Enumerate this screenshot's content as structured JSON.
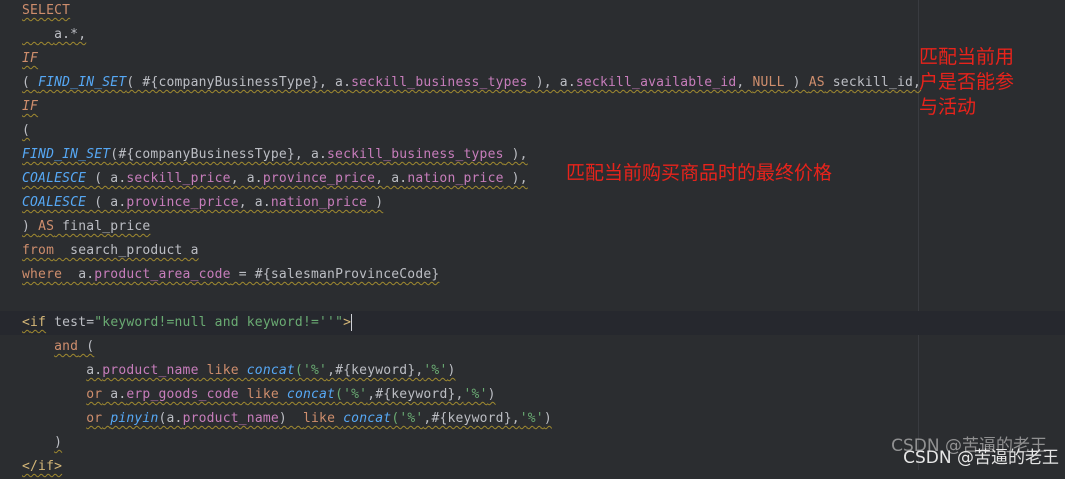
{
  "code": {
    "l1": "SELECT",
    "l2": "a.*,",
    "l3": "IF",
    "l4_open": "( ",
    "l4_fn": "FIND_IN_SET",
    "l4_a": "( #{companyBusinessType}, a.",
    "l4_col1": "seckill_business_types",
    "l4_b": " ), a.",
    "l4_col2": "seckill_available_id",
    "l4_c": ", ",
    "l4_null": "NULL",
    "l4_d": " ) ",
    "l4_as": "AS",
    "l4_e": " seckill_id,",
    "l5": "IF",
    "l6": "(",
    "l7_fn": "FIND_IN_SET",
    "l7_a": "(#{companyBusinessType}, a.",
    "l7_col": "seckill_business_types",
    "l7_b": " ),",
    "l8_fn": "COALESCE",
    "l8_a": " ( a.",
    "l8_col1": "seckill_price",
    "l8_b": ", a.",
    "l8_col2": "province_price",
    "l8_c": ", a.",
    "l8_col3": "nation_price",
    "l8_d": " ),",
    "l9_fn": "COALESCE",
    "l9_a": " ( a.",
    "l9_col1": "province_price",
    "l9_b": ", a.",
    "l9_col2": "nation_price",
    "l9_c": " )",
    "l10_a": ") ",
    "l10_as": "AS",
    "l10_b": " final_price",
    "l11_from": "from",
    "l11_b": "  search_product a",
    "l12_where": "where",
    "l12_a": "  a.",
    "l12_col": "product_area_code",
    "l12_b": " = #{salesmanProvinceCode}",
    "l14_lt": "<",
    "l14_tag": "if",
    "l14_attr": " test",
    "l14_eq": "=",
    "l14_str": "\"keyword!=null and keyword!=''\"",
    "l14_gt": ">",
    "l15_and": "and",
    "l15_b": " (",
    "l16_a": "a.",
    "l16_col": "product_name",
    "l16_like": " like ",
    "l16_fn": "concat",
    "l16_s1": "('%'",
    "l16_b": ",#{keyword},",
    "l16_s2": "'%'",
    "l16_c": ")",
    "l17_or": "or",
    "l17_a": " a.",
    "l17_col": "erp_goods_code",
    "l17_like": " like ",
    "l17_fn": "concat",
    "l17_s1": "('%'",
    "l17_b": ",#{keyword},",
    "l17_s2": "'%'",
    "l17_c": ")",
    "l18_or": "or",
    "l18_sp": " ",
    "l18_fn": "pinyin",
    "l18_a": "(a.",
    "l18_col": "product_name",
    "l18_b": ")  ",
    "l18_like": "like ",
    "l18_fn2": "concat",
    "l18_s1": "('%'",
    "l18_c": ",#{keyword},",
    "l18_s2": "'%'",
    "l18_d": ")",
    "l19": ")",
    "l20": "</if>"
  },
  "annotations": {
    "note1_line1": "匹配当前用",
    "note1_line2": "户是否能参",
    "note1_line3": "与活动",
    "note2": "匹配当前购买商品时的最终价格"
  },
  "watermark": {
    "text": "CSDN @苦逼的老王"
  },
  "colors": {
    "background": "#2b2d30",
    "keyword": "#cf8e6d",
    "function": "#56a8f5",
    "column": "#c77dbb",
    "string": "#6aab73",
    "annotation": "#e8231b"
  }
}
